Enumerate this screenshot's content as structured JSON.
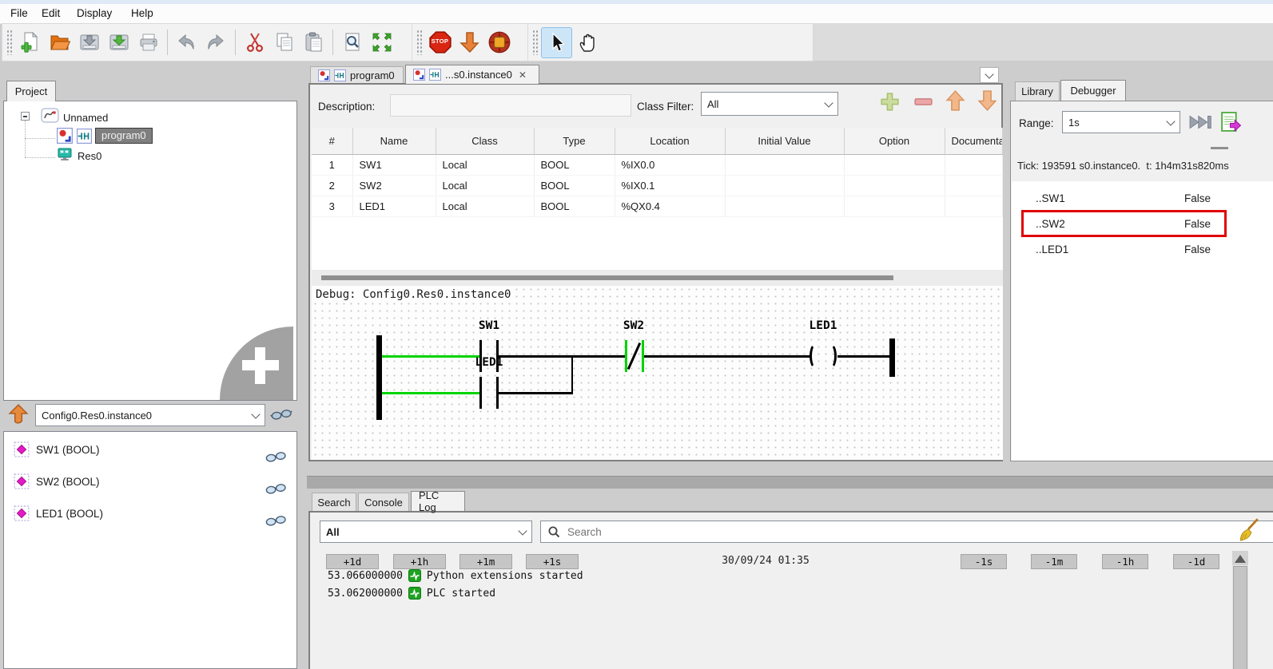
{
  "menu": {
    "items": [
      "File",
      "Edit",
      "Display",
      "Help"
    ]
  },
  "toolbar": {
    "stop_label": "STOP"
  },
  "project": {
    "tab_label": "Project",
    "root_label": "Unnamed",
    "program_label": "program0",
    "resource_label": "Res0"
  },
  "instance_bar": {
    "value": "Config0.Res0.instance0"
  },
  "pou_variables": {
    "items": [
      "SW1 (BOOL)",
      "SW2 (BOOL)",
      "LED1 (BOOL)"
    ]
  },
  "editor": {
    "tabs": [
      "program0",
      "...s0.instance0"
    ],
    "close_glyph": "✕",
    "description_label": "Description:",
    "class_filter_label": "Class Filter:",
    "class_filter_value": "All",
    "table": {
      "headers": [
        "#",
        "Name",
        "Class",
        "Type",
        "Location",
        "Initial Value",
        "Option",
        "Documentation"
      ],
      "rows": [
        [
          "1",
          "SW1",
          "Local",
          "BOOL",
          "%IX0.0",
          "",
          "",
          ""
        ],
        [
          "2",
          "SW2",
          "Local",
          "BOOL",
          "%IX0.1",
          "",
          "",
          ""
        ],
        [
          "3",
          "LED1",
          "Local",
          "BOOL",
          "%QX0.4",
          "",
          "",
          ""
        ]
      ]
    },
    "debug_header": "Debug: Config0.Res0.instance0",
    "ladder": {
      "contact_a": "SW1",
      "contact_b": "SW2",
      "parallel_contact": "LED1",
      "coil": "LED1"
    }
  },
  "debugger": {
    "library_tab": "Library",
    "debugger_tab": "Debugger",
    "range_label": "Range:",
    "range_value": "1s",
    "tick_text": "Tick: 193591 s0.instance0.  t: 1h4m31s820ms",
    "rows": [
      {
        "name": "..SW1",
        "value": "False"
      },
      {
        "name": "..SW2",
        "value": "False"
      },
      {
        "name": "..LED1",
        "value": "False"
      }
    ]
  },
  "log": {
    "tabs": [
      "Search",
      "Console",
      "PLC Log"
    ],
    "filter_value": "All",
    "search_placeholder": "Search",
    "controls_left": [
      "+1d",
      "+1h",
      "+1m",
      "+1s"
    ],
    "date_text": "30/09/24 01:35",
    "controls_right": [
      "-1s",
      "-1m",
      "-1h",
      "-1d"
    ],
    "entries": [
      {
        "time": "53.066000000",
        "message": "Python extensions started"
      },
      {
        "time": "53.062000000",
        "message": "PLC started"
      }
    ]
  }
}
